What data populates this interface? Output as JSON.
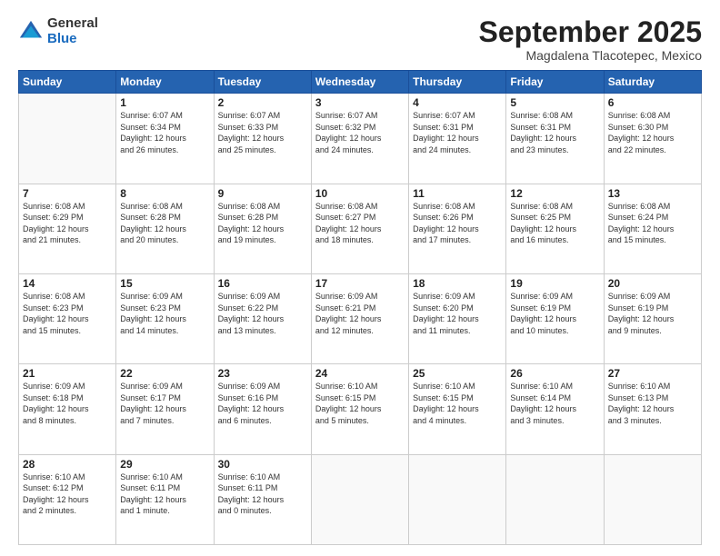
{
  "logo": {
    "general": "General",
    "blue": "Blue"
  },
  "title": "September 2025",
  "location": "Magdalena Tlacotepec, Mexico",
  "headers": [
    "Sunday",
    "Monday",
    "Tuesday",
    "Wednesday",
    "Thursday",
    "Friday",
    "Saturday"
  ],
  "weeks": [
    [
      {
        "day": "",
        "info": ""
      },
      {
        "day": "1",
        "info": "Sunrise: 6:07 AM\nSunset: 6:34 PM\nDaylight: 12 hours\nand 26 minutes."
      },
      {
        "day": "2",
        "info": "Sunrise: 6:07 AM\nSunset: 6:33 PM\nDaylight: 12 hours\nand 25 minutes."
      },
      {
        "day": "3",
        "info": "Sunrise: 6:07 AM\nSunset: 6:32 PM\nDaylight: 12 hours\nand 24 minutes."
      },
      {
        "day": "4",
        "info": "Sunrise: 6:07 AM\nSunset: 6:31 PM\nDaylight: 12 hours\nand 24 minutes."
      },
      {
        "day": "5",
        "info": "Sunrise: 6:08 AM\nSunset: 6:31 PM\nDaylight: 12 hours\nand 23 minutes."
      },
      {
        "day": "6",
        "info": "Sunrise: 6:08 AM\nSunset: 6:30 PM\nDaylight: 12 hours\nand 22 minutes."
      }
    ],
    [
      {
        "day": "7",
        "info": "Sunrise: 6:08 AM\nSunset: 6:29 PM\nDaylight: 12 hours\nand 21 minutes."
      },
      {
        "day": "8",
        "info": "Sunrise: 6:08 AM\nSunset: 6:28 PM\nDaylight: 12 hours\nand 20 minutes."
      },
      {
        "day": "9",
        "info": "Sunrise: 6:08 AM\nSunset: 6:28 PM\nDaylight: 12 hours\nand 19 minutes."
      },
      {
        "day": "10",
        "info": "Sunrise: 6:08 AM\nSunset: 6:27 PM\nDaylight: 12 hours\nand 18 minutes."
      },
      {
        "day": "11",
        "info": "Sunrise: 6:08 AM\nSunset: 6:26 PM\nDaylight: 12 hours\nand 17 minutes."
      },
      {
        "day": "12",
        "info": "Sunrise: 6:08 AM\nSunset: 6:25 PM\nDaylight: 12 hours\nand 16 minutes."
      },
      {
        "day": "13",
        "info": "Sunrise: 6:08 AM\nSunset: 6:24 PM\nDaylight: 12 hours\nand 15 minutes."
      }
    ],
    [
      {
        "day": "14",
        "info": "Sunrise: 6:08 AM\nSunset: 6:23 PM\nDaylight: 12 hours\nand 15 minutes."
      },
      {
        "day": "15",
        "info": "Sunrise: 6:09 AM\nSunset: 6:23 PM\nDaylight: 12 hours\nand 14 minutes."
      },
      {
        "day": "16",
        "info": "Sunrise: 6:09 AM\nSunset: 6:22 PM\nDaylight: 12 hours\nand 13 minutes."
      },
      {
        "day": "17",
        "info": "Sunrise: 6:09 AM\nSunset: 6:21 PM\nDaylight: 12 hours\nand 12 minutes."
      },
      {
        "day": "18",
        "info": "Sunrise: 6:09 AM\nSunset: 6:20 PM\nDaylight: 12 hours\nand 11 minutes."
      },
      {
        "day": "19",
        "info": "Sunrise: 6:09 AM\nSunset: 6:19 PM\nDaylight: 12 hours\nand 10 minutes."
      },
      {
        "day": "20",
        "info": "Sunrise: 6:09 AM\nSunset: 6:19 PM\nDaylight: 12 hours\nand 9 minutes."
      }
    ],
    [
      {
        "day": "21",
        "info": "Sunrise: 6:09 AM\nSunset: 6:18 PM\nDaylight: 12 hours\nand 8 minutes."
      },
      {
        "day": "22",
        "info": "Sunrise: 6:09 AM\nSunset: 6:17 PM\nDaylight: 12 hours\nand 7 minutes."
      },
      {
        "day": "23",
        "info": "Sunrise: 6:09 AM\nSunset: 6:16 PM\nDaylight: 12 hours\nand 6 minutes."
      },
      {
        "day": "24",
        "info": "Sunrise: 6:10 AM\nSunset: 6:15 PM\nDaylight: 12 hours\nand 5 minutes."
      },
      {
        "day": "25",
        "info": "Sunrise: 6:10 AM\nSunset: 6:15 PM\nDaylight: 12 hours\nand 4 minutes."
      },
      {
        "day": "26",
        "info": "Sunrise: 6:10 AM\nSunset: 6:14 PM\nDaylight: 12 hours\nand 3 minutes."
      },
      {
        "day": "27",
        "info": "Sunrise: 6:10 AM\nSunset: 6:13 PM\nDaylight: 12 hours\nand 3 minutes."
      }
    ],
    [
      {
        "day": "28",
        "info": "Sunrise: 6:10 AM\nSunset: 6:12 PM\nDaylight: 12 hours\nand 2 minutes."
      },
      {
        "day": "29",
        "info": "Sunrise: 6:10 AM\nSunset: 6:11 PM\nDaylight: 12 hours\nand 1 minute."
      },
      {
        "day": "30",
        "info": "Sunrise: 6:10 AM\nSunset: 6:11 PM\nDaylight: 12 hours\nand 0 minutes."
      },
      {
        "day": "",
        "info": ""
      },
      {
        "day": "",
        "info": ""
      },
      {
        "day": "",
        "info": ""
      },
      {
        "day": "",
        "info": ""
      }
    ]
  ]
}
